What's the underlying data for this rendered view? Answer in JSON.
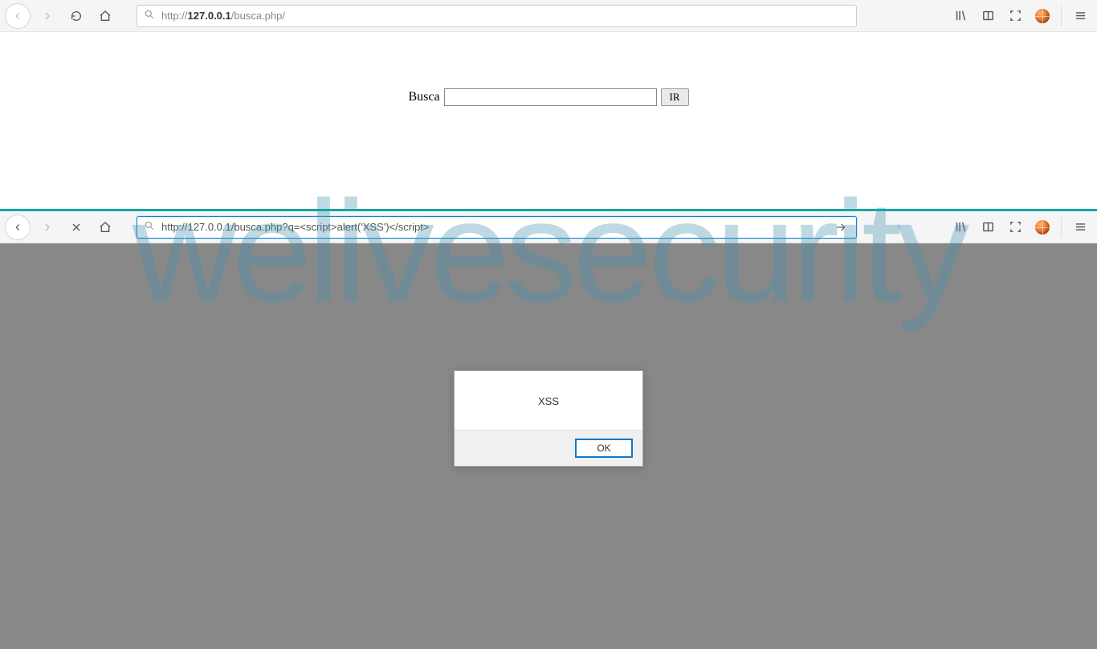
{
  "watermark": "welivesecurity",
  "top_browser": {
    "url_prefix": "http://",
    "url_host": "127.0.0.1",
    "url_path": "/busca.php/",
    "url_full": "http://127.0.0.1/busca.php/"
  },
  "search_form": {
    "label": "Busca",
    "input_value": "",
    "submit_label": "IR"
  },
  "bottom_browser": {
    "url_full": "http://127.0.0.1/busca.php?q=<script>alert('XSS')</script>"
  },
  "alert": {
    "message": "XSS",
    "ok_label": "OK"
  }
}
